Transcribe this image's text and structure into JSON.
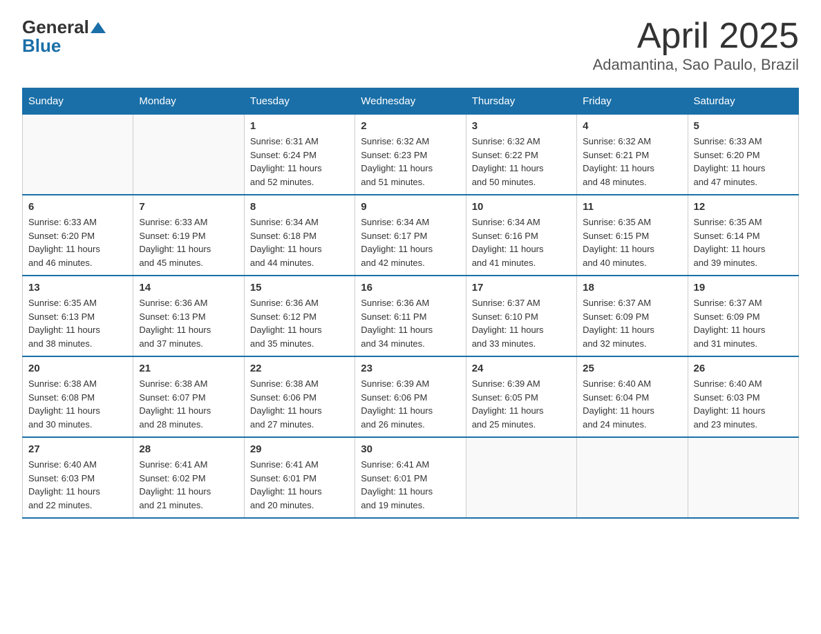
{
  "header": {
    "logo_general": "General",
    "logo_blue": "Blue",
    "title": "April 2025",
    "subtitle": "Adamantina, Sao Paulo, Brazil"
  },
  "days_of_week": [
    "Sunday",
    "Monday",
    "Tuesday",
    "Wednesday",
    "Thursday",
    "Friday",
    "Saturday"
  ],
  "weeks": [
    [
      {
        "day": "",
        "info": ""
      },
      {
        "day": "",
        "info": ""
      },
      {
        "day": "1",
        "info": "Sunrise: 6:31 AM\nSunset: 6:24 PM\nDaylight: 11 hours\nand 52 minutes."
      },
      {
        "day": "2",
        "info": "Sunrise: 6:32 AM\nSunset: 6:23 PM\nDaylight: 11 hours\nand 51 minutes."
      },
      {
        "day": "3",
        "info": "Sunrise: 6:32 AM\nSunset: 6:22 PM\nDaylight: 11 hours\nand 50 minutes."
      },
      {
        "day": "4",
        "info": "Sunrise: 6:32 AM\nSunset: 6:21 PM\nDaylight: 11 hours\nand 48 minutes."
      },
      {
        "day": "5",
        "info": "Sunrise: 6:33 AM\nSunset: 6:20 PM\nDaylight: 11 hours\nand 47 minutes."
      }
    ],
    [
      {
        "day": "6",
        "info": "Sunrise: 6:33 AM\nSunset: 6:20 PM\nDaylight: 11 hours\nand 46 minutes."
      },
      {
        "day": "7",
        "info": "Sunrise: 6:33 AM\nSunset: 6:19 PM\nDaylight: 11 hours\nand 45 minutes."
      },
      {
        "day": "8",
        "info": "Sunrise: 6:34 AM\nSunset: 6:18 PM\nDaylight: 11 hours\nand 44 minutes."
      },
      {
        "day": "9",
        "info": "Sunrise: 6:34 AM\nSunset: 6:17 PM\nDaylight: 11 hours\nand 42 minutes."
      },
      {
        "day": "10",
        "info": "Sunrise: 6:34 AM\nSunset: 6:16 PM\nDaylight: 11 hours\nand 41 minutes."
      },
      {
        "day": "11",
        "info": "Sunrise: 6:35 AM\nSunset: 6:15 PM\nDaylight: 11 hours\nand 40 minutes."
      },
      {
        "day": "12",
        "info": "Sunrise: 6:35 AM\nSunset: 6:14 PM\nDaylight: 11 hours\nand 39 minutes."
      }
    ],
    [
      {
        "day": "13",
        "info": "Sunrise: 6:35 AM\nSunset: 6:13 PM\nDaylight: 11 hours\nand 38 minutes."
      },
      {
        "day": "14",
        "info": "Sunrise: 6:36 AM\nSunset: 6:13 PM\nDaylight: 11 hours\nand 37 minutes."
      },
      {
        "day": "15",
        "info": "Sunrise: 6:36 AM\nSunset: 6:12 PM\nDaylight: 11 hours\nand 35 minutes."
      },
      {
        "day": "16",
        "info": "Sunrise: 6:36 AM\nSunset: 6:11 PM\nDaylight: 11 hours\nand 34 minutes."
      },
      {
        "day": "17",
        "info": "Sunrise: 6:37 AM\nSunset: 6:10 PM\nDaylight: 11 hours\nand 33 minutes."
      },
      {
        "day": "18",
        "info": "Sunrise: 6:37 AM\nSunset: 6:09 PM\nDaylight: 11 hours\nand 32 minutes."
      },
      {
        "day": "19",
        "info": "Sunrise: 6:37 AM\nSunset: 6:09 PM\nDaylight: 11 hours\nand 31 minutes."
      }
    ],
    [
      {
        "day": "20",
        "info": "Sunrise: 6:38 AM\nSunset: 6:08 PM\nDaylight: 11 hours\nand 30 minutes."
      },
      {
        "day": "21",
        "info": "Sunrise: 6:38 AM\nSunset: 6:07 PM\nDaylight: 11 hours\nand 28 minutes."
      },
      {
        "day": "22",
        "info": "Sunrise: 6:38 AM\nSunset: 6:06 PM\nDaylight: 11 hours\nand 27 minutes."
      },
      {
        "day": "23",
        "info": "Sunrise: 6:39 AM\nSunset: 6:06 PM\nDaylight: 11 hours\nand 26 minutes."
      },
      {
        "day": "24",
        "info": "Sunrise: 6:39 AM\nSunset: 6:05 PM\nDaylight: 11 hours\nand 25 minutes."
      },
      {
        "day": "25",
        "info": "Sunrise: 6:40 AM\nSunset: 6:04 PM\nDaylight: 11 hours\nand 24 minutes."
      },
      {
        "day": "26",
        "info": "Sunrise: 6:40 AM\nSunset: 6:03 PM\nDaylight: 11 hours\nand 23 minutes."
      }
    ],
    [
      {
        "day": "27",
        "info": "Sunrise: 6:40 AM\nSunset: 6:03 PM\nDaylight: 11 hours\nand 22 minutes."
      },
      {
        "day": "28",
        "info": "Sunrise: 6:41 AM\nSunset: 6:02 PM\nDaylight: 11 hours\nand 21 minutes."
      },
      {
        "day": "29",
        "info": "Sunrise: 6:41 AM\nSunset: 6:01 PM\nDaylight: 11 hours\nand 20 minutes."
      },
      {
        "day": "30",
        "info": "Sunrise: 6:41 AM\nSunset: 6:01 PM\nDaylight: 11 hours\nand 19 minutes."
      },
      {
        "day": "",
        "info": ""
      },
      {
        "day": "",
        "info": ""
      },
      {
        "day": "",
        "info": ""
      }
    ]
  ]
}
